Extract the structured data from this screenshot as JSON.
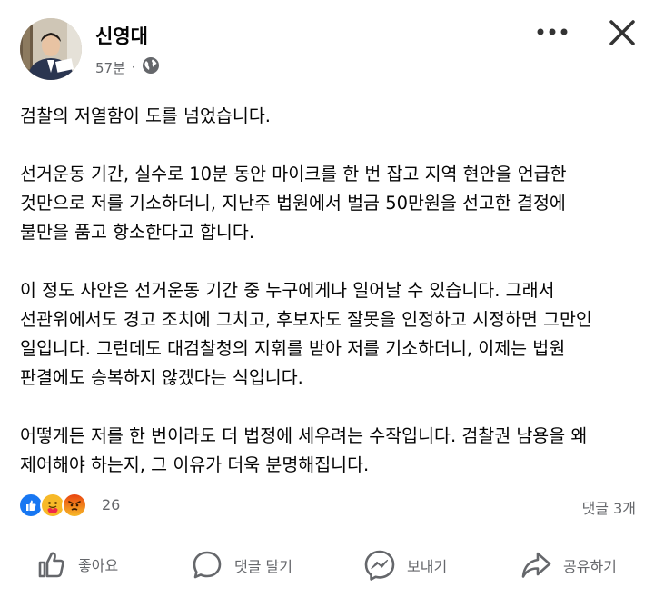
{
  "post": {
    "author": "신영대",
    "time": "57분",
    "dot": "·",
    "paragraphs": [
      [
        "검찰의 저열함이 도를 넘었습니다."
      ],
      [
        "선거운동 기간, 실수로 10분 동안 마이크를 한 번 잡고 지역 현안을 언급한",
        "것만으로 저를 기소하더니, 지난주 법원에서 벌금 50만원을 선고한 결정에",
        "불만을 품고 항소한다고 합니다."
      ],
      [
        "이 정도 사안은 선거운동 기간 중 누구에게나 일어날 수 있습니다. 그래서",
        "선관위에서도 경고 조치에 그치고, 후보자도 잘못을 인정하고 시정하면 그만인",
        "일입니다. 그런데도 대검찰청의 지휘를 받아 저를 기소하더니, 이제는 법원",
        "판결에도 승복하지 않겠다는 식입니다."
      ],
      [
        "어떻게든 저를 한 번이라도 더 법정에 세우려는 수작입니다. 검찰권 남용을 왜",
        "제어해야 하는지, 그 이유가 더욱 분명해집니다."
      ]
    ]
  },
  "reactions": {
    "icons": [
      "like-icon",
      "care-icon",
      "angry-icon"
    ],
    "count": "26",
    "comments": "댓글 3개"
  },
  "actions": {
    "like": "좋아요",
    "comment": "댓글 달기",
    "send": "보내기",
    "share": "공유하기"
  },
  "colors": {
    "text": "#050505",
    "secondary": "#65676b",
    "like_blue": "#1877f2",
    "care_yellow": "#f7b928",
    "angry_orange": "#e9710f"
  }
}
